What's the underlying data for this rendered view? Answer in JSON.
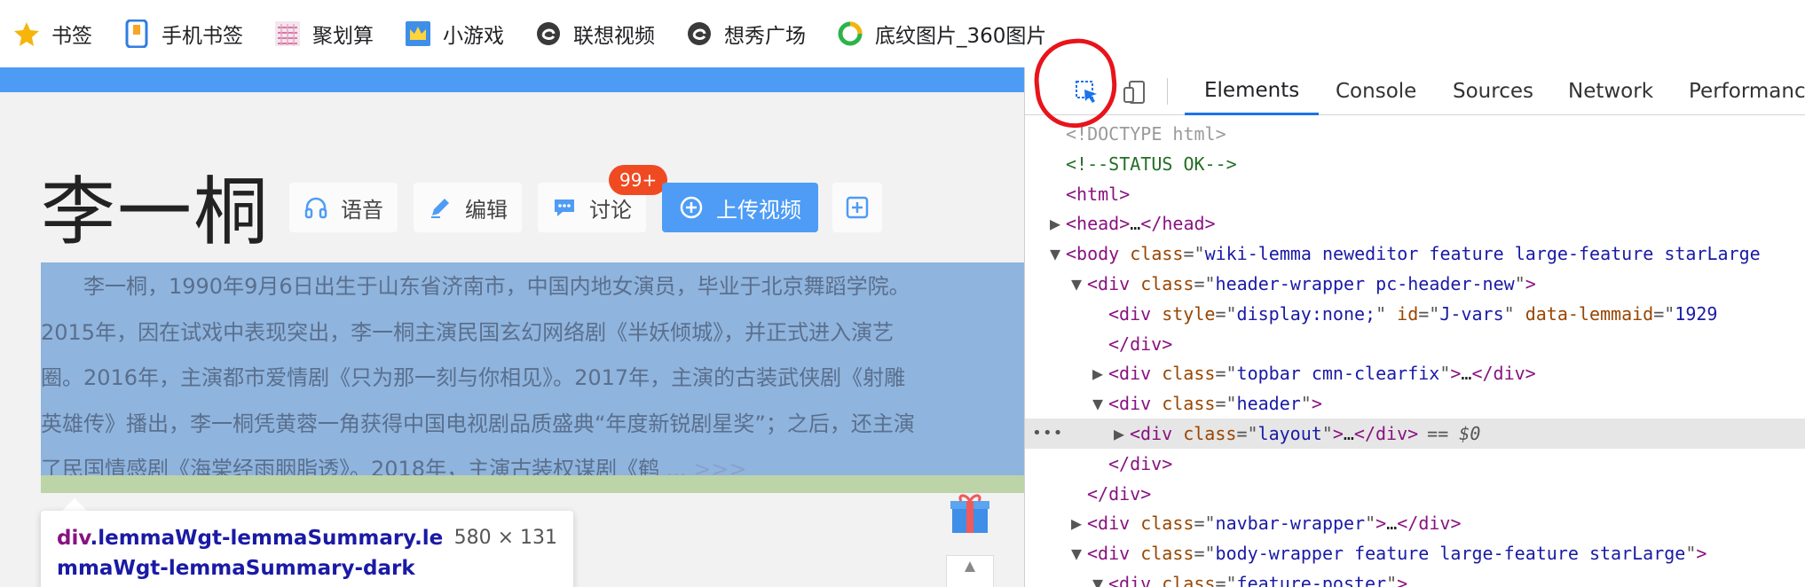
{
  "bookmarks": [
    {
      "label": "书签",
      "icon": "star-icon"
    },
    {
      "label": "手机书签",
      "icon": "phone-bookmark-icon"
    },
    {
      "label": "聚划算",
      "icon": "juhuasuan-icon"
    },
    {
      "label": "小游戏",
      "icon": "game-crown-icon"
    },
    {
      "label": "联想视频",
      "icon": "lenovo-e-icon"
    },
    {
      "label": "想秀广场",
      "icon": "lenovo-e-icon"
    },
    {
      "label": "底纹图片_360图片",
      "icon": "360-ring-icon"
    }
  ],
  "page": {
    "title": "李一桐",
    "actions": {
      "voice": "语音",
      "edit": "编辑",
      "discuss": "讨论",
      "discuss_badge": "99+",
      "upload_video": "上传视频"
    },
    "summary_lines": [
      "　　李一桐，1990年9月6日出生于山东省济南市，中国内地女演员，毕业于北京舞蹈学院。",
      "2015年，因在试戏中表现突出，李一桐主演民国玄幻网络剧《半妖倾城》，并正式进入演艺",
      "圈。2016年，主演都市爱情剧《只为那一刻与你相见》。2017年，主演的古装武侠剧《射雕",
      "英雄传》播出，李一桐凭黄蓉一角获得中国电视剧品质盛典“年度新锐剧星奖”；之后，还主演",
      "了民国情感剧《海棠经雨胭脂透》。2018年，主演古装权谋剧《鹤"
    ],
    "summary_more": "... >>>",
    "tooltip": {
      "tag": "div",
      "class_text": ".lemmaWgt-lemmaSummary.lemmaWgt-lemmaSummary-dark",
      "size": "580 × 131"
    }
  },
  "devtools": {
    "tabs": [
      "Elements",
      "Console",
      "Sources",
      "Network",
      "Performance"
    ],
    "active_tab": "Elements",
    "selected_suffix": "== $0",
    "code": [
      {
        "indent": 0,
        "tri": "",
        "parts": [
          {
            "c": "c-doc",
            "t": "<!DOCTYPE html>"
          }
        ]
      },
      {
        "indent": 0,
        "tri": "",
        "parts": [
          {
            "c": "c-com",
            "t": "<!--STATUS OK-->"
          }
        ]
      },
      {
        "indent": 0,
        "tri": "",
        "parts": [
          {
            "c": "c-tag",
            "t": "<html>"
          }
        ]
      },
      {
        "indent": 0,
        "tri": "▶",
        "parts": [
          {
            "c": "c-tag",
            "t": "<head>"
          },
          {
            "c": "c-txt",
            "t": "…"
          },
          {
            "c": "c-tag",
            "t": "</head>"
          }
        ]
      },
      {
        "indent": 0,
        "tri": "▼",
        "parts": [
          {
            "c": "c-tag",
            "t": "<body "
          },
          {
            "c": "c-an",
            "t": "class"
          },
          {
            "c": "c-eq",
            "t": "=\""
          },
          {
            "c": "c-av",
            "t": "wiki-lemma neweditor feature large-feature starLarge"
          }
        ]
      },
      {
        "indent": 1,
        "tri": "▼",
        "parts": [
          {
            "c": "c-tag",
            "t": "<div "
          },
          {
            "c": "c-an",
            "t": "class"
          },
          {
            "c": "c-eq",
            "t": "=\""
          },
          {
            "c": "c-av",
            "t": "header-wrapper pc-header-new"
          },
          {
            "c": "c-eq",
            "t": "\""
          },
          {
            "c": "c-tag",
            "t": ">"
          }
        ]
      },
      {
        "indent": 2,
        "tri": "",
        "parts": [
          {
            "c": "c-tag",
            "t": "<div "
          },
          {
            "c": "c-an",
            "t": "style"
          },
          {
            "c": "c-eq",
            "t": "=\""
          },
          {
            "c": "c-av",
            "t": "display:none;"
          },
          {
            "c": "c-eq",
            "t": "\" "
          },
          {
            "c": "c-an",
            "t": "id"
          },
          {
            "c": "c-eq",
            "t": "=\""
          },
          {
            "c": "c-av",
            "t": "J-vars"
          },
          {
            "c": "c-eq",
            "t": "\" "
          },
          {
            "c": "c-an",
            "t": "data-lemmaid"
          },
          {
            "c": "c-eq",
            "t": "=\""
          },
          {
            "c": "c-av",
            "t": "1929"
          }
        ]
      },
      {
        "indent": 2,
        "tri": "",
        "parts": [
          {
            "c": "c-tag",
            "t": "</div>"
          }
        ]
      },
      {
        "indent": 2,
        "tri": "▶",
        "parts": [
          {
            "c": "c-tag",
            "t": "<div "
          },
          {
            "c": "c-an",
            "t": "class"
          },
          {
            "c": "c-eq",
            "t": "=\""
          },
          {
            "c": "c-av",
            "t": "topbar cmn-clearfix"
          },
          {
            "c": "c-eq",
            "t": "\""
          },
          {
            "c": "c-tag",
            "t": ">"
          },
          {
            "c": "c-txt",
            "t": "…"
          },
          {
            "c": "c-tag",
            "t": "</div>"
          }
        ]
      },
      {
        "indent": 2,
        "tri": "▼",
        "parts": [
          {
            "c": "c-tag",
            "t": "<div "
          },
          {
            "c": "c-an",
            "t": "class"
          },
          {
            "c": "c-eq",
            "t": "=\""
          },
          {
            "c": "c-av",
            "t": "header"
          },
          {
            "c": "c-eq",
            "t": "\""
          },
          {
            "c": "c-tag",
            "t": ">"
          }
        ]
      },
      {
        "indent": 3,
        "tri": "▶",
        "hl": true,
        "parts": [
          {
            "c": "c-tag",
            "t": "<div "
          },
          {
            "c": "c-an",
            "t": "class"
          },
          {
            "c": "c-eq",
            "t": "=\""
          },
          {
            "c": "c-av",
            "t": "layout"
          },
          {
            "c": "c-eq",
            "t": "\""
          },
          {
            "c": "c-tag",
            "t": ">"
          },
          {
            "c": "c-txt",
            "t": "…"
          },
          {
            "c": "c-tag",
            "t": "</div>"
          }
        ]
      },
      {
        "indent": 2,
        "tri": "",
        "parts": [
          {
            "c": "c-tag",
            "t": "</div>"
          }
        ]
      },
      {
        "indent": 1,
        "tri": "",
        "parts": [
          {
            "c": "c-tag",
            "t": "</div>"
          }
        ]
      },
      {
        "indent": 1,
        "tri": "▶",
        "parts": [
          {
            "c": "c-tag",
            "t": "<div "
          },
          {
            "c": "c-an",
            "t": "class"
          },
          {
            "c": "c-eq",
            "t": "=\""
          },
          {
            "c": "c-av",
            "t": "navbar-wrapper"
          },
          {
            "c": "c-eq",
            "t": "\""
          },
          {
            "c": "c-tag",
            "t": ">"
          },
          {
            "c": "c-txt",
            "t": "…"
          },
          {
            "c": "c-tag",
            "t": "</div>"
          }
        ]
      },
      {
        "indent": 1,
        "tri": "▼",
        "parts": [
          {
            "c": "c-tag",
            "t": "<div "
          },
          {
            "c": "c-an",
            "t": "class"
          },
          {
            "c": "c-eq",
            "t": "=\""
          },
          {
            "c": "c-av",
            "t": "body-wrapper feature large-feature starLarge"
          },
          {
            "c": "c-eq",
            "t": "\""
          },
          {
            "c": "c-tag",
            "t": ">"
          }
        ]
      },
      {
        "indent": 2,
        "tri": "▼",
        "parts": [
          {
            "c": "c-tag",
            "t": "<div "
          },
          {
            "c": "c-an",
            "t": "class"
          },
          {
            "c": "c-eq",
            "t": "=\""
          },
          {
            "c": "c-av",
            "t": "feature-poster"
          },
          {
            "c": "c-eq",
            "t": "\""
          },
          {
            "c": "c-tag",
            "t": ">"
          }
        ]
      }
    ]
  }
}
